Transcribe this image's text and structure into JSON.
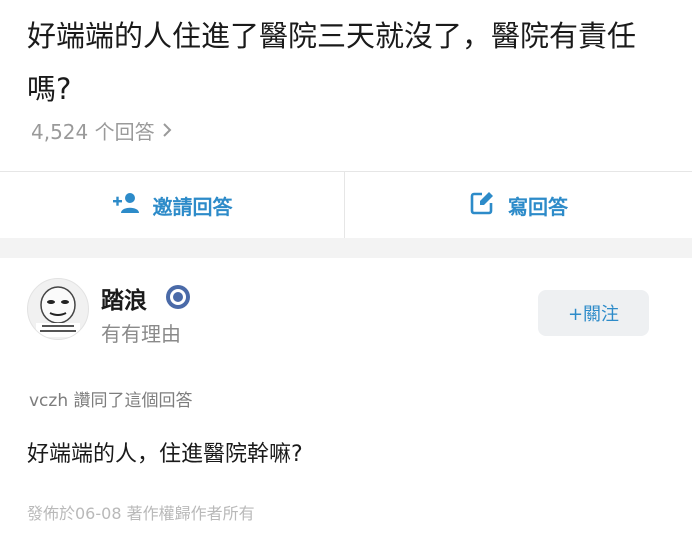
{
  "question": {
    "title": "好端端的人住進了醫院三天就沒了，醫院有責任嗎?",
    "answer_count_text": "4,524 个回答",
    "chevron_icon": "chevron-right-icon"
  },
  "actions": {
    "invite_label": "邀請回答",
    "invite_icon": "add-user-icon",
    "write_label": "寫回答",
    "write_icon": "edit-icon"
  },
  "answer": {
    "author_name": "踏浪",
    "author_bio": "有有理由",
    "badge_icon": "verified-badge-icon",
    "follow_label": "+關注",
    "voted_text": "vczh 讚同了這個回答",
    "content": "好端端的人，住進醫院幹嘛?",
    "footer": "發佈於06-08 著作權歸作者所有"
  },
  "colors": {
    "accent": "#2d8bc9",
    "text_primary": "#1a1a1a",
    "text_secondary": "#9a9a9a",
    "band": "#f3f3f3"
  }
}
